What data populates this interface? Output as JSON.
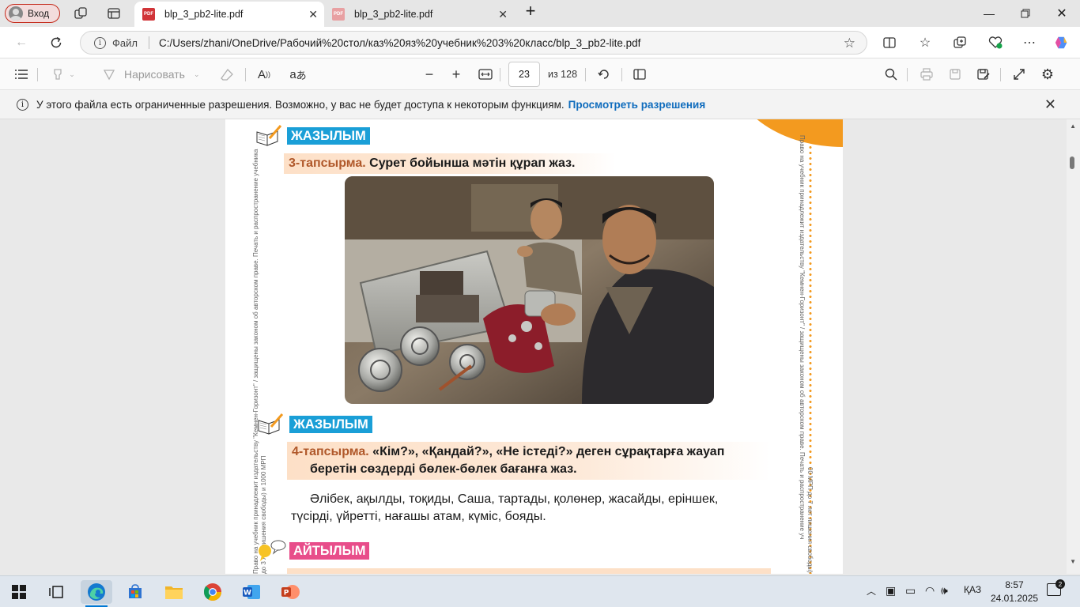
{
  "browser": {
    "profile_label": "Вход",
    "tabs": [
      {
        "title": "blp_3_pb2-lite.pdf",
        "active": true
      },
      {
        "title": "blp_3_pb2-lite.pdf",
        "active": false
      }
    ],
    "address": {
      "scheme_label": "Файл",
      "url": "C:/Users/zhani/OneDrive/Рабочий%20стол/каз%20яз%20учебник%203%20класс/blp_3_pb2-lite.pdf"
    }
  },
  "pdf_toolbar": {
    "draw_label": "Нарисовать",
    "current_page": "23",
    "page_total": "из 128"
  },
  "banner": {
    "text": "У этого файла есть ограниченные разрешения. Возможно, у вас не будет доступа к некоторым функциям.",
    "link": "Просмотреть разрешения"
  },
  "page": {
    "section1": "ЖАЗЫЛЫМ",
    "task3_num": "3-тапсырма.",
    "task3_text": " Сурет бойынша мәтін құрап жаз.",
    "section2": "ЖАЗЫЛЫМ",
    "task4_num": "4-тапсырма.",
    "task4_text_line1": " «Кім?», «Қандай?», «Не істеді?» деген сұрақтарға жауап",
    "task4_text_line2": "беретін сөздерді бөлек-бөлек бағанға жаз.",
    "words_line1": "Әлібек, ақылды, тоқиды, Саша, тартады, қолөнер, жасайды, еріншек,",
    "words_line2": "түсірді, үйретті, нағашы атам, күміс, бояды.",
    "section3": "АЙТЫЛЫМ",
    "side_text_left": "Право на учебник принадлежит издательству \"Кемнен-Горизонт\" / защищены законом об авторском праве. Печать и распространение учебника",
    "side_text_left2": "до 3 лет лишения свободы) и 1000 МРП",
    "side_text_right": "Право на учебник принадлежит издательству \"Кемнен-Горизонт\" / защищены законом об авторском праве. Печать и распространение уч",
    "side_text_right2": "00 МРП до 7 лет лишения свободы)"
  },
  "taskbar": {
    "lang": "ҚАЗ",
    "time": "8:57",
    "date": "24.01.2025",
    "notif_count": "2"
  },
  "colors": {
    "section_blue": "#1a9fd7",
    "section_pink": "#e84d8a",
    "task_num": "#b0582a",
    "link": "#0f6cbd",
    "orange": "#f39a1f"
  }
}
